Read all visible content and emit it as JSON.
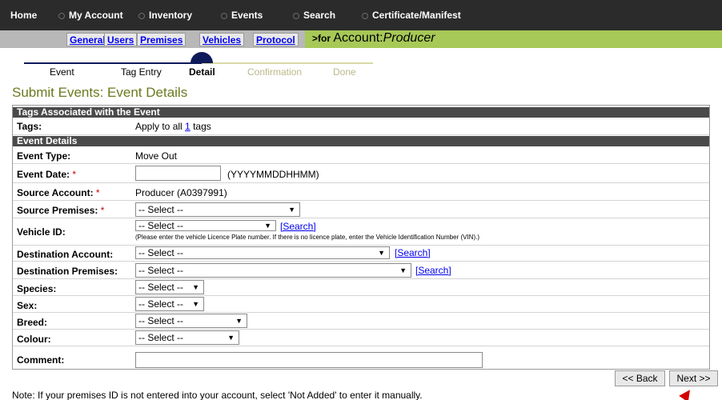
{
  "topnav": {
    "items": [
      "Home",
      "My Account",
      "Inventory",
      "Events",
      "Search",
      "Certificate/Manifest"
    ]
  },
  "subnav": {
    "tabs": [
      "General",
      "Users",
      "Premises",
      "Vehicles",
      "Protocol"
    ],
    "account_prefix": ">for",
    "account_word": "Account:",
    "account_name": "Producer"
  },
  "steps": [
    "Event",
    "Tag Entry",
    "Detail",
    "Confirmation",
    "Done"
  ],
  "page_title": "Submit Events: Event Details",
  "tags_section": {
    "header": "Tags Associated with the Event",
    "label": "Tags:",
    "apply_prefix": "Apply to all ",
    "count": "1",
    "apply_suffix": " tags"
  },
  "details_section": {
    "header": "Event Details",
    "event_type_label": "Event Type:",
    "event_type_value": "Move Out",
    "event_date_label": "Event Date:",
    "event_date_format": "(YYYYMMDDHHMM)",
    "source_account_label": "Source Account:",
    "source_account_value": "Producer (A0397991)",
    "source_premises_label": "Source Premises:",
    "vehicle_label": "Vehicle ID:",
    "vehicle_note": "(Please enter the vehicle Licence Plate number. If there is no licence plate, enter the Vehicle Identification Number (VIN).)",
    "dest_account_label": "Destination Account:",
    "dest_premises_label": "Destination Premises:",
    "species_label": "Species:",
    "sex_label": "Sex:",
    "breed_label": "Breed:",
    "colour_label": "Colour:",
    "comment_label": "Comment:",
    "required_mark": "*",
    "select_placeholder": "-- Select --",
    "search_link": "[Search]",
    "arrow": "▼"
  },
  "buttons": {
    "back": "<< Back",
    "next": "Next >>"
  },
  "footer_note": "Note: If your premises ID is not entered into your account, select 'Not Added' to enter it manually.",
  "colors": {
    "topnav": "#2b2b2b",
    "subnav_green": "#a7c957",
    "title": "#6b7a1f",
    "step_line_done": "#0f1a5a",
    "step_line_future": "#d9d9a6"
  }
}
